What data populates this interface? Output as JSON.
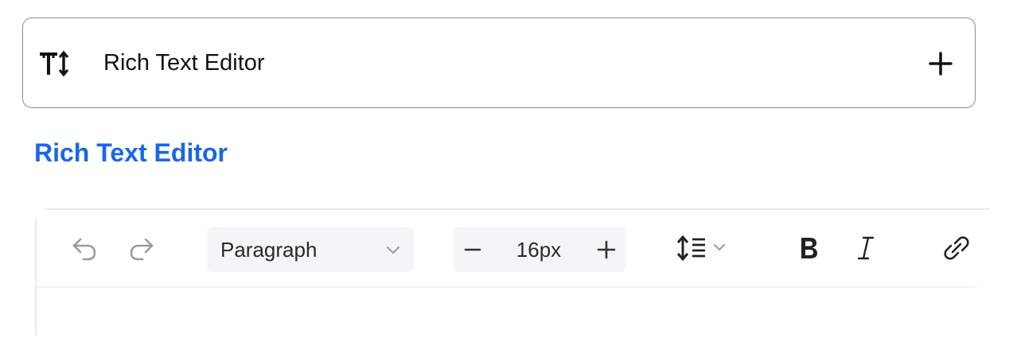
{
  "card": {
    "title": "Rich Text Editor",
    "leading_icon": "text-size-icon",
    "action_icon": "plus-icon"
  },
  "section": {
    "title": "Rich Text Editor",
    "accent_color": "#1a66e8"
  },
  "toolbar": {
    "undo_icon": "undo-icon",
    "redo_icon": "redo-icon",
    "block_format": {
      "selected": "Paragraph",
      "icon": "chevron-down-icon"
    },
    "font_size": {
      "value": "16px",
      "decrease_icon": "minus-icon",
      "increase_icon": "plus-icon"
    },
    "line_height_icon": "line-height-icon",
    "bold_icon": "bold-icon",
    "italic_icon": "italic-icon",
    "link_icon": "link-icon"
  }
}
